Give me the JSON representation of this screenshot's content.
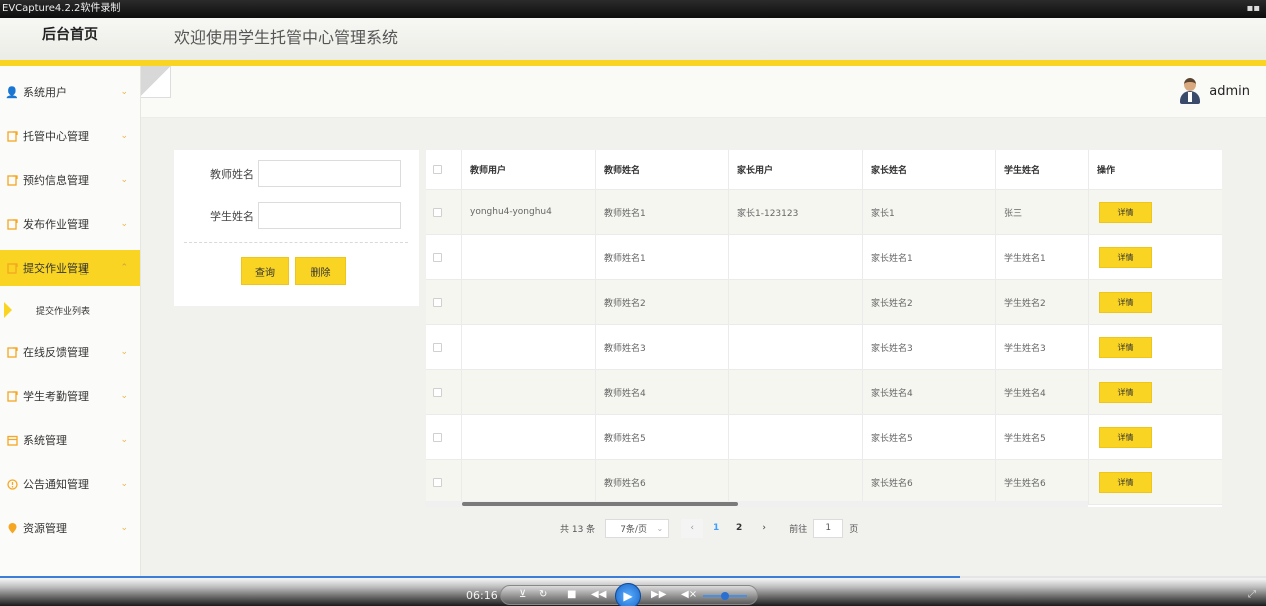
{
  "recorder": {
    "title": "EVCapture4.2.2软件录制",
    "time": "06:16"
  },
  "header": {
    "brand": "后台首页",
    "site_title": "欢迎使用学生托管中心管理系统"
  },
  "user": {
    "name": "admin"
  },
  "colors": {
    "accent": "#f9d423",
    "link": "#409eff"
  },
  "sidebar": {
    "items": [
      {
        "label": "系统用户",
        "icon": "user-icon"
      },
      {
        "label": "托管中心管理",
        "icon": "note-icon"
      },
      {
        "label": "预约信息管理",
        "icon": "note-icon"
      },
      {
        "label": "发布作业管理",
        "icon": "note-icon"
      },
      {
        "label": "提交作业管理",
        "icon": "note-icon",
        "active": true
      },
      {
        "label": "在线反馈管理",
        "icon": "note-icon"
      },
      {
        "label": "学生考勤管理",
        "icon": "note-icon"
      },
      {
        "label": "系统管理",
        "icon": "calendar-icon"
      },
      {
        "label": "公告通知管理",
        "icon": "info-icon"
      },
      {
        "label": "资源管理",
        "icon": "location-icon"
      }
    ],
    "sub_item": "提交作业列表"
  },
  "search": {
    "teacher_label": "教师姓名",
    "teacher_value": "",
    "student_label": "学生姓名",
    "student_value": "",
    "query_button": "查询",
    "delete_button": "删除"
  },
  "table": {
    "columns": [
      "教师用户",
      "教师姓名",
      "家长用户",
      "家长姓名",
      "学生姓名",
      "操作"
    ],
    "detail_label": "详情",
    "rows": [
      [
        "yonghu4-yonghu4",
        "教师姓名1",
        "家长1-123123",
        "家长1",
        "张三"
      ],
      [
        "",
        "教师姓名1",
        "",
        "家长姓名1",
        "学生姓名1"
      ],
      [
        "",
        "教师姓名2",
        "",
        "家长姓名2",
        "学生姓名2"
      ],
      [
        "",
        "教师姓名3",
        "",
        "家长姓名3",
        "学生姓名3"
      ],
      [
        "",
        "教师姓名4",
        "",
        "家长姓名4",
        "学生姓名4"
      ],
      [
        "",
        "教师姓名5",
        "",
        "家长姓名5",
        "学生姓名5"
      ],
      [
        "",
        "教师姓名6",
        "",
        "家长姓名6",
        "学生姓名6"
      ]
    ]
  },
  "pagination": {
    "total": "共 13 条",
    "page_size": "7条/页",
    "pages": [
      "1",
      "2"
    ],
    "current": "1",
    "goto_prefix": "前往",
    "goto_value": "1",
    "goto_suffix": "页"
  }
}
